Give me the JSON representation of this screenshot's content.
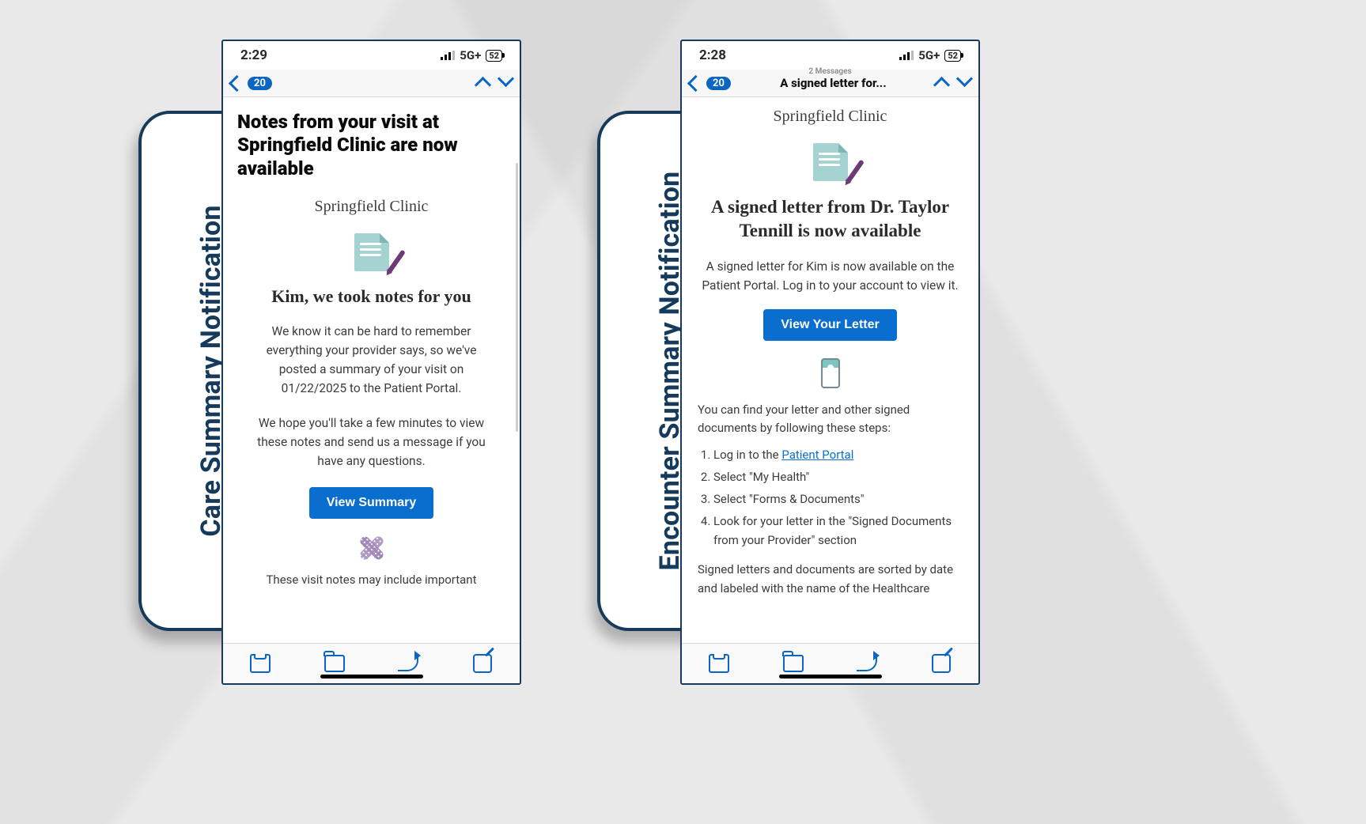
{
  "phones": [
    {
      "tab_label": "Care Summary Notification",
      "status": {
        "time": "2:29",
        "network": "5G+",
        "battery": "52"
      },
      "header": {
        "badge": "20",
        "title": "",
        "subtitle": ""
      },
      "email": {
        "subject": "Notes from your visit at Springfield Clinic are now available",
        "clinic": "Springfield Clinic",
        "heading": "Kim, we took notes for you",
        "body1": "We know it can be hard to remember everything your provider says, so we've posted a summary of your visit on 01/22/2025 to the Patient Portal.",
        "body2": "We hope you'll take a few minutes to view these notes and send us a message if you have any questions.",
        "cta": "View Summary",
        "footer1": "These visit notes may include important"
      }
    },
    {
      "tab_label": "Encounter Summary Notification",
      "status": {
        "time": "2:28",
        "network": "5G+",
        "battery": "52"
      },
      "header": {
        "badge": "20",
        "title": "A signed letter for...",
        "subtitle": "2 Messages"
      },
      "email": {
        "clinic": "Springfield Clinic",
        "heading": "A signed letter from Dr. Taylor Tennill is now available",
        "body1": "A signed letter for Kim is now available on the Patient Portal. Log in to your account to view it.",
        "cta": "View Your Letter",
        "intro": "You can find your letter and other signed documents by following these steps:",
        "steps": [
          {
            "pre": "Log in to the ",
            "link": "Patient Portal"
          },
          {
            "pre": "Select \"My Health\""
          },
          {
            "pre": "Select \"Forms & Documents\""
          },
          {
            "pre": "Look for your letter in the \"Signed Documents from your Provider\" section"
          }
        ],
        "footer1": "Signed letters and documents are sorted by date and labeled with the name of the Healthcare"
      }
    }
  ]
}
